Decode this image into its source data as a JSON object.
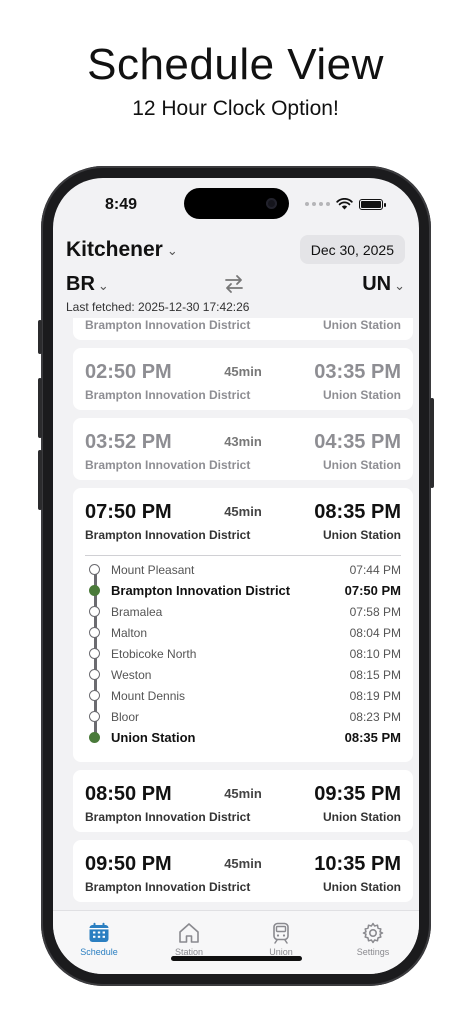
{
  "promo": {
    "title": "Schedule View",
    "subtitle": "12 Hour Clock Option!"
  },
  "status_bar": {
    "time": "8:49",
    "icons": [
      "signal-dots-icon",
      "wifi-icon",
      "battery-icon"
    ]
  },
  "header": {
    "line_name": "Kitchener",
    "date": "Dec 30, 2025",
    "from_code": "BR",
    "to_code": "UN",
    "last_fetched": "Last fetched: 2025-12-30 17:42:26"
  },
  "partial_card": {
    "from": "Brampton Innovation District",
    "to": "Union Station"
  },
  "trips": [
    {
      "dep": "02:50 PM",
      "dur": "45min",
      "arr": "03:35 PM",
      "from": "Brampton Innovation District",
      "to": "Union Station",
      "past": true
    },
    {
      "dep": "03:52 PM",
      "dur": "43min",
      "arr": "04:35 PM",
      "from": "Brampton Innovation District",
      "to": "Union Station",
      "past": true
    },
    {
      "dep": "07:50 PM",
      "dur": "45min",
      "arr": "08:35 PM",
      "from": "Brampton Innovation District",
      "to": "Union Station",
      "past": false,
      "expanded": true
    },
    {
      "dep": "08:50 PM",
      "dur": "45min",
      "arr": "09:35 PM",
      "from": "Brampton Innovation District",
      "to": "Union Station",
      "past": false
    },
    {
      "dep": "09:50 PM",
      "dur": "45min",
      "arr": "10:35 PM",
      "from": "Brampton Innovation District",
      "to": "Union Station",
      "past": false
    }
  ],
  "stops": [
    {
      "name": "Mount Pleasant",
      "time": "07:44 PM",
      "highlight": false
    },
    {
      "name": "Brampton Innovation District",
      "time": "07:50 PM",
      "highlight": true
    },
    {
      "name": "Bramalea",
      "time": "07:58 PM",
      "highlight": false
    },
    {
      "name": "Malton",
      "time": "08:04 PM",
      "highlight": false
    },
    {
      "name": "Etobicoke North",
      "time": "08:10 PM",
      "highlight": false
    },
    {
      "name": "Weston",
      "time": "08:15 PM",
      "highlight": false
    },
    {
      "name": "Mount Dennis",
      "time": "08:19 PM",
      "highlight": false
    },
    {
      "name": "Bloor",
      "time": "08:23 PM",
      "highlight": false
    },
    {
      "name": "Union Station",
      "time": "08:35 PM",
      "highlight": true
    }
  ],
  "tabs": [
    {
      "label": "Schedule",
      "icon": "calendar-icon",
      "active": true
    },
    {
      "label": "Station",
      "icon": "house-icon",
      "active": false
    },
    {
      "label": "Union",
      "icon": "train-icon",
      "active": false
    },
    {
      "label": "Settings",
      "icon": "gear-icon",
      "active": false
    }
  ],
  "colors": {
    "accent": "#2b7fc1",
    "stop_active": "#4a7a3a",
    "muted_text": "#8e8e93",
    "background": "#f2f2f4"
  }
}
